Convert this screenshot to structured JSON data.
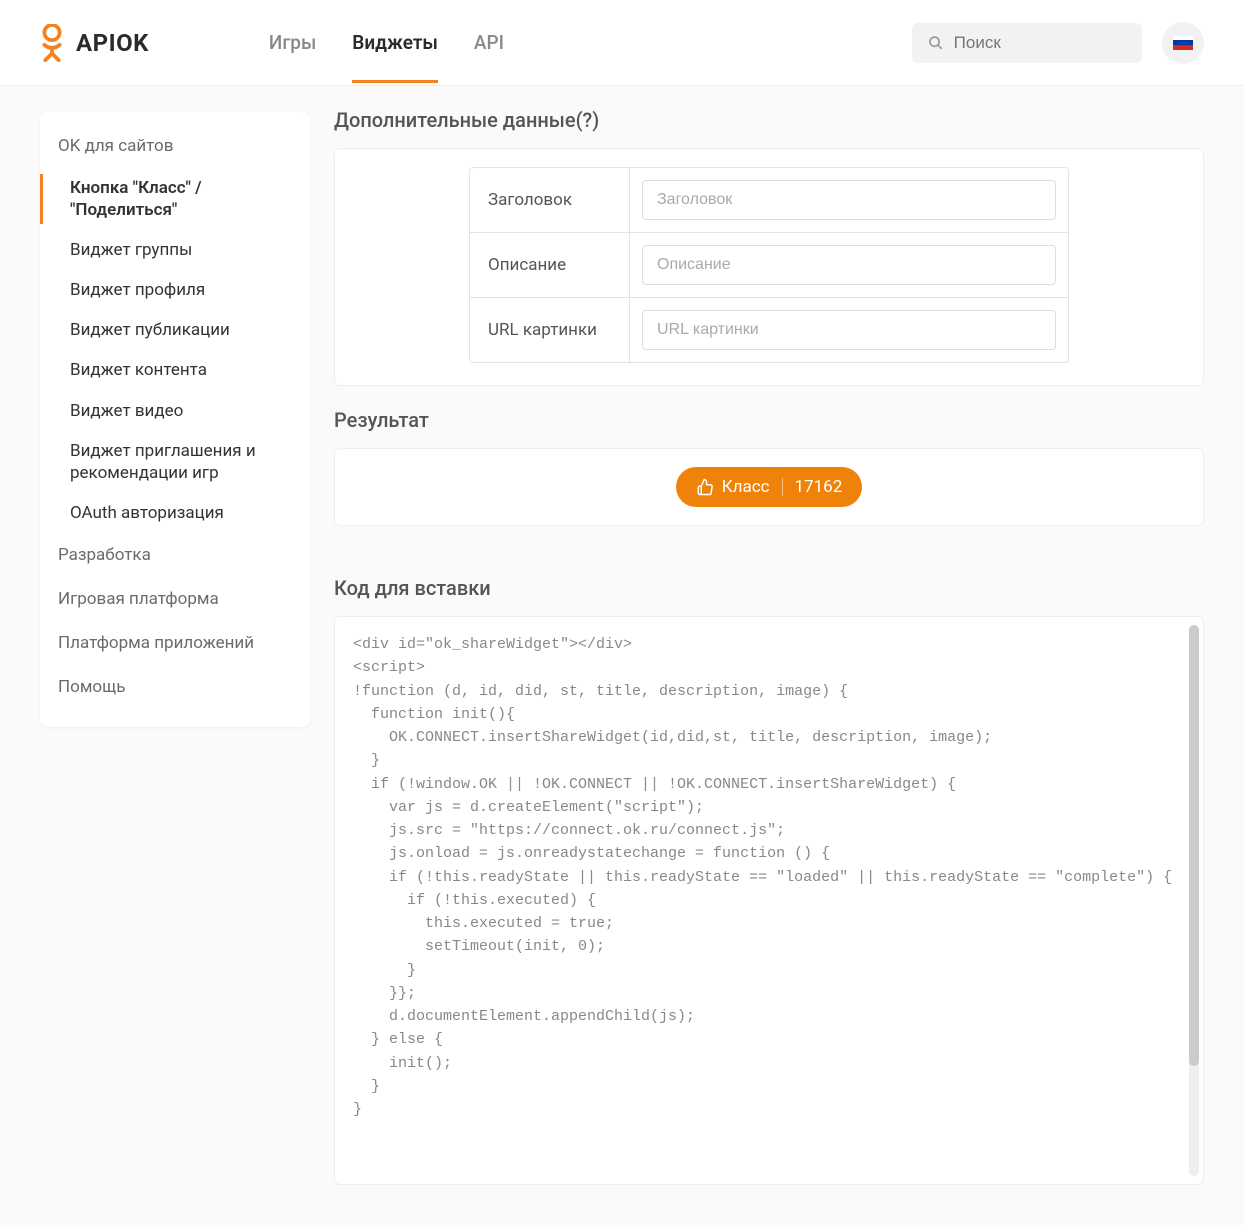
{
  "header": {
    "logo_text": "APIOK",
    "nav": [
      {
        "label": "Игры",
        "active": false
      },
      {
        "label": "Виджеты",
        "active": true
      },
      {
        "label": "API",
        "active": false
      }
    ],
    "search_placeholder": "Поиск",
    "locale": "ru"
  },
  "sidebar": {
    "sections": [
      {
        "label": "OK для сайтов",
        "items": [
          {
            "label": "Кнопка \"Класс\" / \"Поделиться\"",
            "active": true
          },
          {
            "label": "Виджет группы"
          },
          {
            "label": "Виджет профиля"
          },
          {
            "label": "Виджет публикации"
          },
          {
            "label": "Виджет контента"
          },
          {
            "label": "Виджет видео"
          },
          {
            "label": "Виджет приглашения и рекомендации игр"
          },
          {
            "label": "OAuth авторизация"
          }
        ]
      },
      {
        "label": "Разработка",
        "items": []
      },
      {
        "label": "Игровая платформа",
        "items": []
      },
      {
        "label": "Платформа приложений",
        "items": []
      },
      {
        "label": "Помощь",
        "items": []
      }
    ]
  },
  "main": {
    "additional_heading": "Дополнительные данные(?)",
    "fields": {
      "title_label": "Заголовок",
      "title_placeholder": "Заголовок",
      "description_label": "Описание",
      "description_placeholder": "Описание",
      "image_label": "URL картинки",
      "image_placeholder": "URL картинки"
    },
    "result_heading": "Результат",
    "ok_button": {
      "label": "Класс",
      "count": "17162"
    },
    "code_heading": "Код для вставки",
    "code": "<div id=\"ok_shareWidget\"></div>\n<script>\n!function (d, id, did, st, title, description, image) {\n  function init(){\n    OK.CONNECT.insertShareWidget(id,did,st, title, description, image);\n  }\n  if (!window.OK || !OK.CONNECT || !OK.CONNECT.insertShareWidget) {\n    var js = d.createElement(\"script\");\n    js.src = \"https://connect.ok.ru/connect.js\";\n    js.onload = js.onreadystatechange = function () {\n    if (!this.readyState || this.readyState == \"loaded\" || this.readyState == \"complete\") {\n      if (!this.executed) {\n        this.executed = true;\n        setTimeout(init, 0);\n      }\n    }};\n    d.documentElement.appendChild(js);\n  } else {\n    init();\n  }\n}"
  }
}
